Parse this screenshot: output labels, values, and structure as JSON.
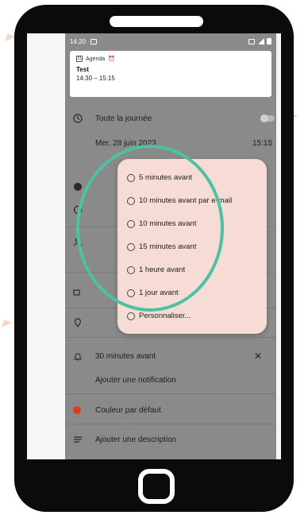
{
  "status_bar": {
    "time": "14:20"
  },
  "notification": {
    "app_name": "Agenda",
    "title": "Test",
    "times": "14:30 – 15:15"
  },
  "event": {
    "all_day_label": "Toute la journée",
    "date": "Mer. 28 juin 2023",
    "time": "15:15",
    "reminder": "30 minutes avant",
    "add_notification": "Ajouter une notification",
    "color_label": "Couleur par défaut",
    "add_description": "Ajouter une description"
  },
  "reminder_dialog": {
    "options": [
      "5 minutes avant",
      "10 minutes avant par e-mail",
      "10 minutes avant",
      "15 minutes avant",
      "1 heure avant",
      "1 jour avant",
      "Personnaliser..."
    ]
  },
  "colors": {
    "highlight": "#4cc1a3",
    "event_color": "#d93d1f",
    "dialog_bg": "#f7dcd6"
  }
}
